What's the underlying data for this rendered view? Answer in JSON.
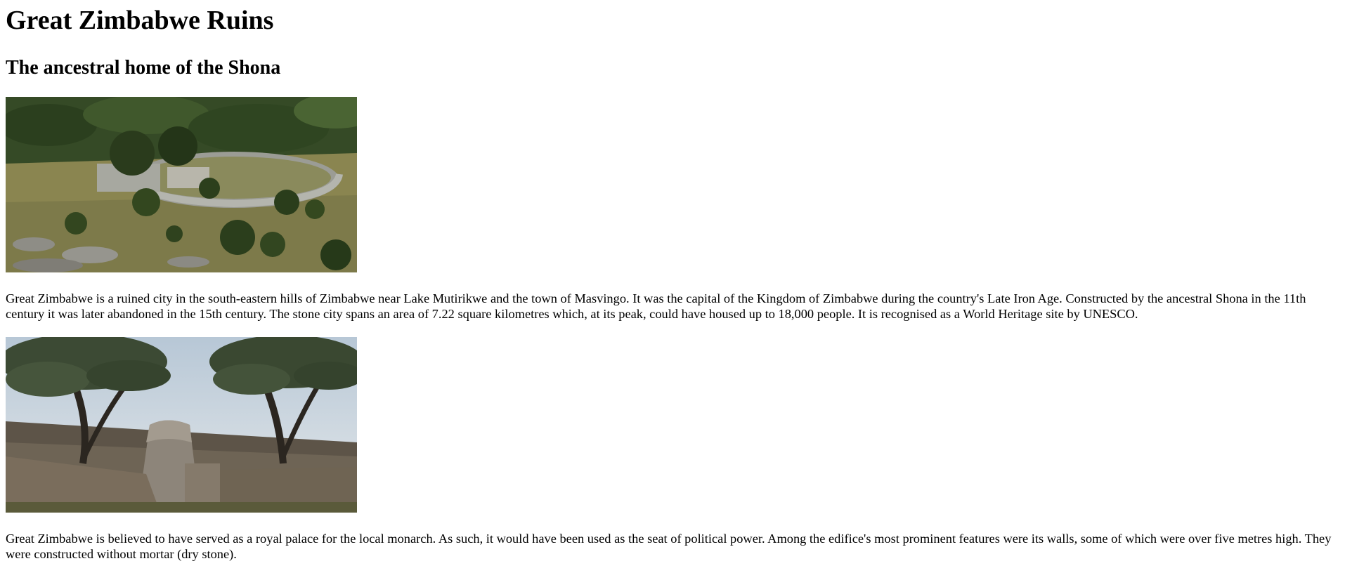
{
  "page": {
    "title": "Great Zimbabwe Ruins",
    "subtitle": "The ancestral home of the Shona",
    "images": [
      {
        "icon": "aerial-ruins-photo"
      },
      {
        "icon": "conical-tower-photo"
      }
    ],
    "paragraphs": [
      "Great Zimbabwe is a ruined city in the south-eastern hills of Zimbabwe near Lake Mutirikwe and the town of Masvingo. It was the capital of the Kingdom of Zimbabwe during the country's Late Iron Age. Constructed by the ancestral Shona in the 11th century it was later abandoned in the 15th century. The stone city spans an area of 7.22 square kilometres which, at its peak, could have housed up to 18,000 people. It is recognised as a World Heritage site by UNESCO.",
      "Great Zimbabwe is believed to have served as a royal palace for the local monarch. As such, it would have been used as the seat of political power. Among the edifice's most prominent features were its walls, some of which were over five metres high. They were constructed without mortar (dry stone)."
    ]
  }
}
